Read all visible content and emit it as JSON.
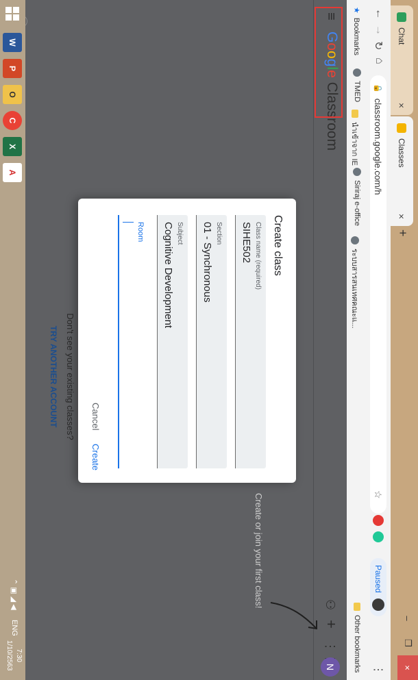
{
  "browser": {
    "tabs": [
      {
        "title": "Chat",
        "icon": "chat-icon",
        "active": false
      },
      {
        "title": "Classes",
        "icon": "classroom-icon",
        "active": true
      }
    ],
    "new_tab": "+",
    "url": "classroom.google.com/h",
    "profile_status": "Paused",
    "bookmarks": [
      {
        "label": "Bookmarks",
        "icon": "star-icon"
      },
      {
        "label": "TMED",
        "icon": "globe-icon"
      },
      {
        "label": "นำเข้าจาก IE",
        "icon": "folder-icon"
      },
      {
        "label": "Siriraj e-office",
        "icon": "globe-icon"
      },
      {
        "label": "ระบบสารสนเทศคณะแ...",
        "icon": "globe-icon"
      },
      {
        "label": "Other bookmarks",
        "icon": "folder-icon"
      }
    ]
  },
  "app": {
    "logo_google": [
      "G",
      "o",
      "o",
      "g",
      "l",
      "e"
    ],
    "logo_rest": " Classroom",
    "avatar_initial": "N",
    "empty_prompt": "Create or join your first class!",
    "existing_question": "Don't see your existing classes?",
    "try_account": "TRY ANOTHER ACCOUNT"
  },
  "dialog": {
    "title": "Create class",
    "fields": [
      {
        "label": "Class name (required)",
        "value": "SIHE502"
      },
      {
        "label": "Section",
        "value": "01 - Synchronous"
      },
      {
        "label": "Subject",
        "value": "Cognitive Development"
      },
      {
        "label": "Room",
        "value": ""
      }
    ],
    "cancel": "Cancel",
    "create": "Create"
  },
  "taskbar": {
    "apps": [
      "W",
      "P",
      "O",
      "C",
      "X",
      "A"
    ],
    "language": "ENG",
    "time": "7:30",
    "date": "1/10/2563"
  },
  "colors": {
    "accent": "#1a73e8",
    "highlight_box": "#e53935",
    "avatar": "#6e57a8",
    "backdrop": "#5f6063"
  }
}
